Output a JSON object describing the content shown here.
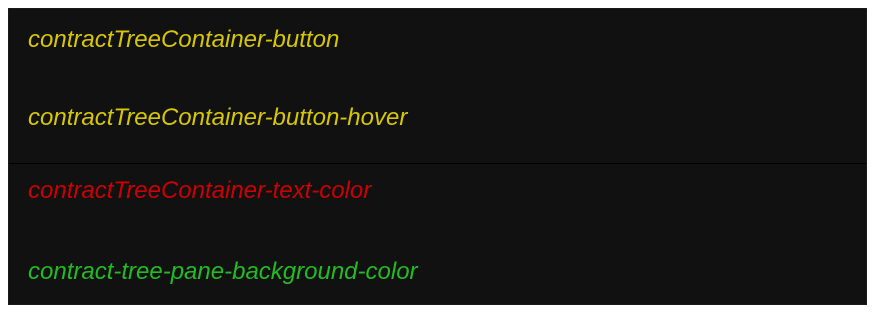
{
  "colors": {
    "background": "#111111",
    "yellow": "#d6c700",
    "red": "#cc0000",
    "green": "#22bb22"
  },
  "items": [
    {
      "label": "contractTreeContainer-button",
      "color": "#d6c700"
    },
    {
      "label": "contractTreeContainer-button-hover",
      "color": "#d6c700"
    },
    {
      "label": "contractTreeContainer-text-color",
      "color": "#cc0000"
    },
    {
      "label": "contract-tree-pane-background-color",
      "color": "#22bb22"
    }
  ]
}
